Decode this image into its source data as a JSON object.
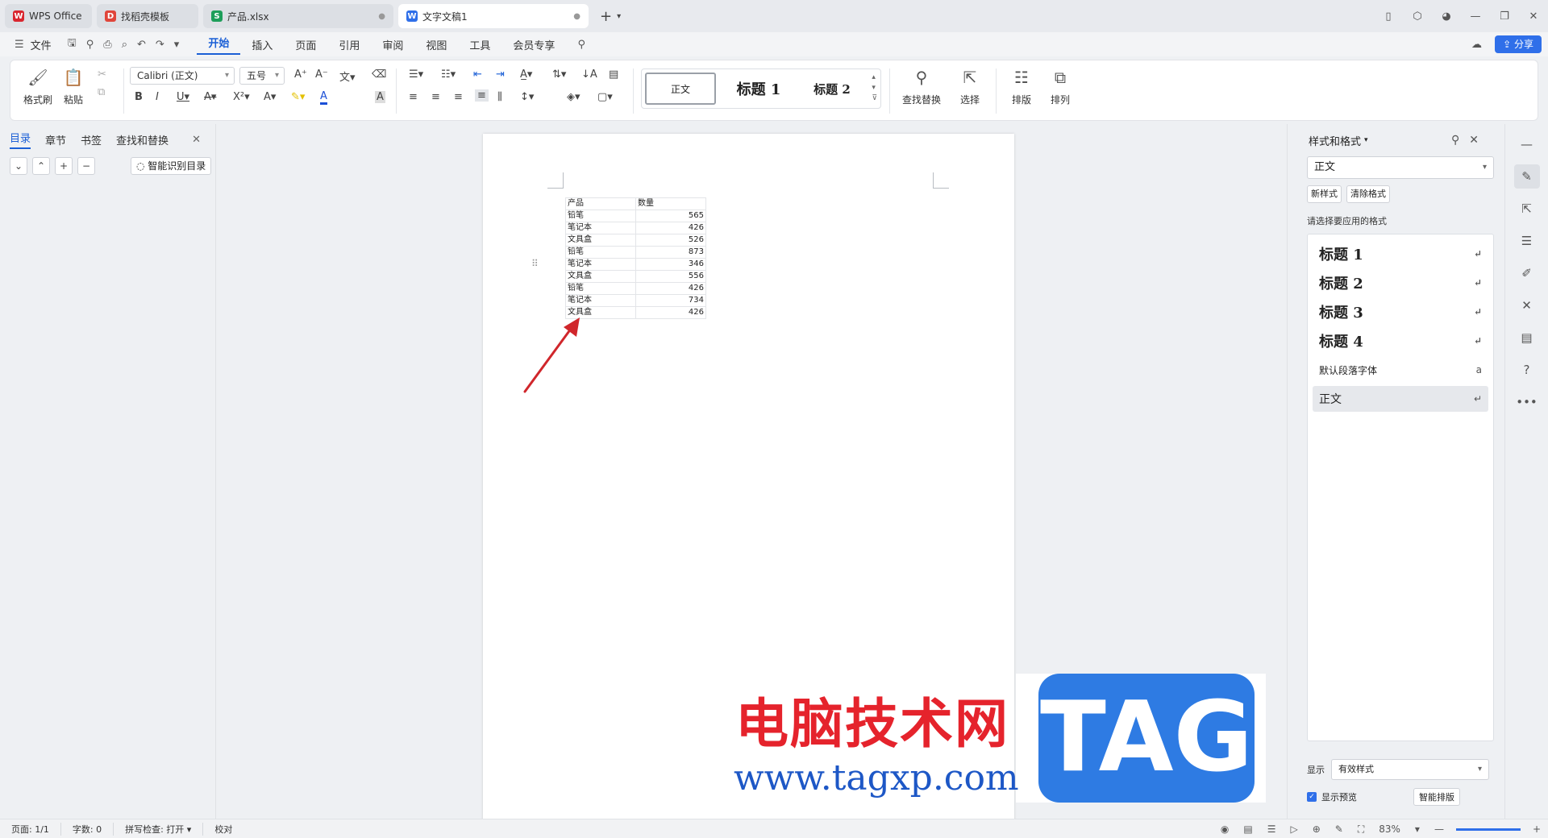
{
  "tabs": [
    {
      "label": "WPS Office",
      "color": "#d9262f",
      "glyph": "W"
    },
    {
      "label": "找稻壳模板",
      "color": "#e0453a",
      "glyph": "D"
    },
    {
      "label": "产品.xlsx",
      "color": "#1e9e5a",
      "glyph": "S"
    },
    {
      "label": "文字文稿1",
      "color": "#2f6fe9",
      "glyph": "W"
    }
  ],
  "menu": {
    "file": "文件",
    "items": [
      "开始",
      "插入",
      "页面",
      "引用",
      "审阅",
      "视图",
      "工具",
      "会员专享"
    ],
    "active": "开始",
    "share": "分享"
  },
  "ribbon": {
    "format_brush": "格式刷",
    "paste": "粘贴",
    "font": "Calibri (正文)",
    "size": "五号",
    "styles": [
      "正文",
      "标题 1",
      "标题 2"
    ],
    "find_replace": "查找替换",
    "select": "选择",
    "layout": "排版",
    "arrange": "排列"
  },
  "nav": {
    "tabs": [
      "目录",
      "章节",
      "书签",
      "查找和替换"
    ],
    "smart_toc": "智能识别目录"
  },
  "table": {
    "headers": [
      "产品",
      "数量"
    ],
    "rows": [
      [
        "铅笔",
        "565"
      ],
      [
        "笔记本",
        "426"
      ],
      [
        "文具盒",
        "526"
      ],
      [
        "铅笔",
        "873"
      ],
      [
        "笔记本",
        "346"
      ],
      [
        "文具盒",
        "556"
      ],
      [
        "铅笔",
        "426"
      ],
      [
        "笔记本",
        "734"
      ],
      [
        "文具盒",
        "426"
      ]
    ]
  },
  "watermark": {
    "cn": "电脑技术网",
    "url": "www.tagxp.com",
    "tag": "TAG"
  },
  "style_pane": {
    "title": "样式和格式",
    "current": "正文",
    "new_style": "新样式",
    "clear_format": "清除格式",
    "prompt": "请选择要应用的格式",
    "list": [
      "标题 1",
      "标题 2",
      "标题 3",
      "标题 4",
      "默认段落字体",
      "正文"
    ],
    "show_label": "显示",
    "show_value": "有效样式",
    "preview": "显示预览",
    "smart_layout": "智能排版"
  },
  "status": {
    "page": "页面: 1/1",
    "words": "字数: 0",
    "spell": "拼写检查: 打开",
    "proof": "校对",
    "zoom": "83%"
  },
  "colors": {
    "accent": "#2f6fe9",
    "arrow": "#d0262b"
  }
}
